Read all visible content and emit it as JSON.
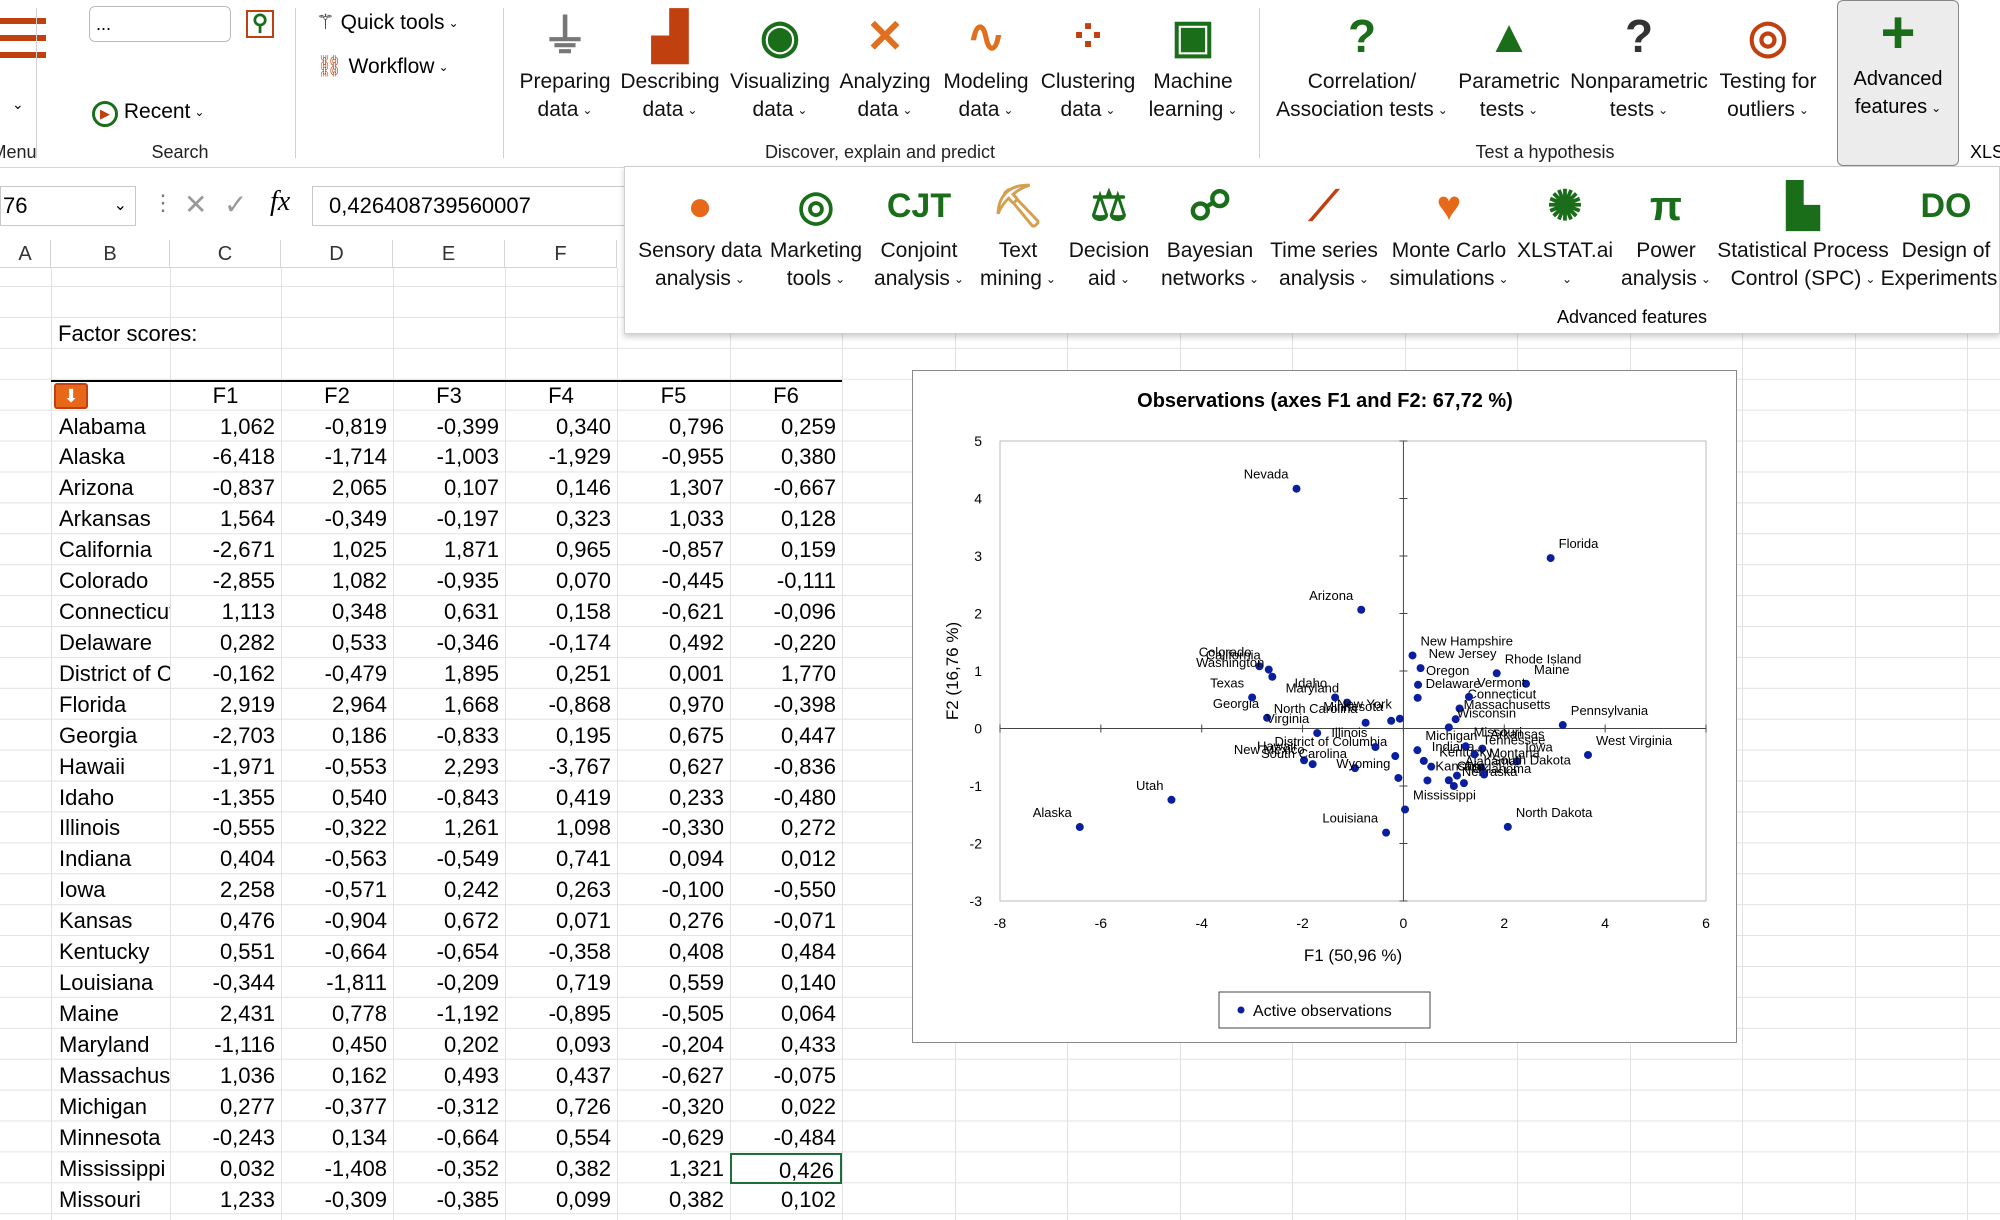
{
  "ribbon": {
    "menu_label": "Menu",
    "search": {
      "value": "...",
      "group_label": "Search",
      "recent_label": "Recent"
    },
    "quick_tools_label": "Quick tools",
    "workflow_label": "Workflow",
    "discover_group_label": "Discover, explain and predict",
    "discover_items": [
      {
        "line1": "Preparing",
        "line2": "data",
        "icon": "funnel-icon"
      },
      {
        "line1": "Describing",
        "line2": "data",
        "icon": "bar-chart-icon"
      },
      {
        "line1": "Visualizing",
        "line2": "data",
        "icon": "eye-icon"
      },
      {
        "line1": "Analyzing",
        "line2": "data",
        "icon": "scatter-cross-icon"
      },
      {
        "line1": "Modeling",
        "line2": "data",
        "icon": "curve-grid-icon"
      },
      {
        "line1": "Clustering",
        "line2": "data",
        "icon": "clusters-icon"
      },
      {
        "line1": "Machine",
        "line2": "learning",
        "icon": "monitor-network-icon"
      }
    ],
    "test_group_label": "Test a hypothesis",
    "test_items": [
      {
        "line1": "Correlation/",
        "line2": "Association tests",
        "icon": "correlation-question-icon"
      },
      {
        "line1": "Parametric",
        "line2": "tests",
        "icon": "bell-curve-icon"
      },
      {
        "line1": "Nonparametric",
        "line2": "tests",
        "icon": "ranks-question-icon"
      },
      {
        "line1": "Testing for",
        "line2": "outliers",
        "icon": "target-icon"
      }
    ],
    "advanced": {
      "line1": "Advanced",
      "line2": "features",
      "icon": "plus-icon"
    },
    "xls_label": "XLS"
  },
  "advanced_panel": {
    "group_label": "Advanced features",
    "items": [
      {
        "line1": "Sensory data",
        "line2": "analysis",
        "icon": "orange-fruit-icon"
      },
      {
        "line1": "Marketing",
        "line2": "tools",
        "icon": "target-cursor-icon"
      },
      {
        "line1": "Conjoint",
        "line2": "analysis",
        "icon": "cjt-icon"
      },
      {
        "line1": "Text",
        "line2": "mining",
        "icon": "pickaxe-text-icon"
      },
      {
        "line1": "Decision",
        "line2": "aid",
        "icon": "decision-icon"
      },
      {
        "line1": "Bayesian",
        "line2": "networks",
        "icon": "network-bn-icon"
      },
      {
        "line1": "Time series",
        "line2": "analysis",
        "icon": "time-series-icon"
      },
      {
        "line1": "Monte Carlo",
        "line2": "simulations",
        "icon": "cards-icon"
      },
      {
        "line1": "XLSTAT.ai",
        "line2": "",
        "icon": "ai-brain-icon"
      },
      {
        "line1": "Power",
        "line2": "analysis",
        "icon": "pi-icon"
      },
      {
        "line1": "Statistical Process",
        "line2": "Control (SPC)",
        "icon": "spc-ruler-icon"
      },
      {
        "line1": "Design of",
        "line2": "Experiments",
        "icon": "doe-icon"
      }
    ]
  },
  "formula_bar": {
    "name_box": "76",
    "formula": "0,426408739560007"
  },
  "columns": [
    "A",
    "B",
    "C",
    "D",
    "E",
    "F"
  ],
  "table": {
    "title": "Factor scores:",
    "headers": [
      "F1",
      "F2",
      "F3",
      "F4",
      "F5",
      "F6"
    ],
    "rows": [
      [
        "Alabama",
        "1,062",
        "-0,819",
        "-0,399",
        "0,340",
        "0,796",
        "0,259"
      ],
      [
        "Alaska",
        "-6,418",
        "-1,714",
        "-1,003",
        "-1,929",
        "-0,955",
        "0,380"
      ],
      [
        "Arizona",
        "-0,837",
        "2,065",
        "0,107",
        "0,146",
        "1,307",
        "-0,667"
      ],
      [
        "Arkansas",
        "1,564",
        "-0,349",
        "-0,197",
        "0,323",
        "1,033",
        "0,128"
      ],
      [
        "California",
        "-2,671",
        "1,025",
        "1,871",
        "0,965",
        "-0,857",
        "0,159"
      ],
      [
        "Colorado",
        "-2,855",
        "1,082",
        "-0,935",
        "0,070",
        "-0,445",
        "-0,111"
      ],
      [
        "Connecticut",
        "1,113",
        "0,348",
        "0,631",
        "0,158",
        "-0,621",
        "-0,096"
      ],
      [
        "Delaware",
        "0,282",
        "0,533",
        "-0,346",
        "-0,174",
        "0,492",
        "-0,220"
      ],
      [
        "District of Columbia",
        "-0,162",
        "-0,479",
        "1,895",
        "0,251",
        "0,001",
        "1,770"
      ],
      [
        "Florida",
        "2,919",
        "2,964",
        "1,668",
        "-0,868",
        "0,970",
        "-0,398"
      ],
      [
        "Georgia",
        "-2,703",
        "0,186",
        "-0,833",
        "0,195",
        "0,675",
        "0,447"
      ],
      [
        "Hawaii",
        "-1,971",
        "-0,553",
        "2,293",
        "-3,767",
        "0,627",
        "-0,836"
      ],
      [
        "Idaho",
        "-1,355",
        "0,540",
        "-0,843",
        "0,419",
        "0,233",
        "-0,480"
      ],
      [
        "Illinois",
        "-0,555",
        "-0,322",
        "1,261",
        "1,098",
        "-0,330",
        "0,272"
      ],
      [
        "Indiana",
        "0,404",
        "-0,563",
        "-0,549",
        "0,741",
        "0,094",
        "0,012"
      ],
      [
        "Iowa",
        "2,258",
        "-0,571",
        "0,242",
        "0,263",
        "-0,100",
        "-0,550"
      ],
      [
        "Kansas",
        "0,476",
        "-0,904",
        "0,672",
        "0,071",
        "0,276",
        "-0,071"
      ],
      [
        "Kentucky",
        "0,551",
        "-0,664",
        "-0,654",
        "-0,358",
        "0,408",
        "0,484"
      ],
      [
        "Louisiana",
        "-0,344",
        "-1,811",
        "-0,209",
        "0,719",
        "0,559",
        "0,140"
      ],
      [
        "Maine",
        "2,431",
        "0,778",
        "-1,192",
        "-0,895",
        "-0,505",
        "0,064"
      ],
      [
        "Maryland",
        "-1,116",
        "0,450",
        "0,202",
        "0,093",
        "-0,204",
        "0,433"
      ],
      [
        "Massachusetts",
        "1,036",
        "0,162",
        "0,493",
        "0,437",
        "-0,627",
        "-0,075"
      ],
      [
        "Michigan",
        "0,277",
        "-0,377",
        "-0,312",
        "0,726",
        "-0,320",
        "0,022"
      ],
      [
        "Minnesota",
        "-0,243",
        "0,134",
        "-0,664",
        "0,554",
        "-0,629",
        "-0,484"
      ],
      [
        "Mississippi",
        "0,032",
        "-1,408",
        "-0,352",
        "0,382",
        "1,321",
        "0,426"
      ],
      [
        "Missouri",
        "1,233",
        "-0,309",
        "-0,385",
        "0,099",
        "0,382",
        "0,102"
      ]
    ]
  },
  "chart_data": {
    "type": "scatter",
    "title": "Observations (axes F1 and F2: 67,72 %)",
    "xlabel": "F1 (50,96 %)",
    "ylabel": "F2 (16,76 %)",
    "xlim": [
      -8,
      6
    ],
    "ylim": [
      -3,
      5
    ],
    "xticks": [
      "-8",
      "-6",
      "-4",
      "-2",
      "0",
      "2",
      "4",
      "6"
    ],
    "yticks": [
      "-3",
      "-2",
      "-1",
      "0",
      "1",
      "2",
      "3",
      "4",
      "5"
    ],
    "legend": {
      "position": "bottom",
      "entries": [
        "Active observations"
      ]
    },
    "color": "#0a1f9e",
    "series": [
      {
        "name": "Active observations",
        "points": [
          [
            "Alabama",
            1.062,
            -0.819
          ],
          [
            "Alaska",
            -6.418,
            -1.714
          ],
          [
            "Arizona",
            -0.837,
            2.065
          ],
          [
            "Arkansas",
            1.564,
            -0.349
          ],
          [
            "California",
            -2.671,
            1.025
          ],
          [
            "Colorado",
            -2.855,
            1.082
          ],
          [
            "Connecticut",
            1.113,
            0.348
          ],
          [
            "Delaware",
            0.282,
            0.533
          ],
          [
            "District of Columbia",
            -0.162,
            -0.479
          ],
          [
            "Florida",
            2.919,
            2.964
          ],
          [
            "Georgia",
            -2.703,
            0.186
          ],
          [
            "Hawaii",
            -1.971,
            -0.553
          ],
          [
            "Idaho",
            -1.355,
            0.54
          ],
          [
            "Illinois",
            -0.555,
            -0.322
          ],
          [
            "Indiana",
            0.404,
            -0.563
          ],
          [
            "Iowa",
            2.258,
            -0.571
          ],
          [
            "Kansas",
            0.476,
            -0.904
          ],
          [
            "Kentucky",
            0.551,
            -0.664
          ],
          [
            "Louisiana",
            -0.344,
            -1.811
          ],
          [
            "Maine",
            2.431,
            0.778
          ],
          [
            "Maryland",
            -1.116,
            0.45
          ],
          [
            "Massachusetts",
            1.036,
            0.162
          ],
          [
            "Michigan",
            0.277,
            -0.377
          ],
          [
            "Minnesota",
            -0.243,
            0.134
          ],
          [
            "Mississippi",
            0.032,
            -1.408
          ],
          [
            "Missouri",
            1.233,
            -0.309
          ],
          [
            "Montana",
            1.54,
            -0.68
          ],
          [
            "Nebraska",
            1.0,
            -1.0
          ],
          [
            "Nevada",
            -2.12,
            4.17
          ],
          [
            "New Hampshire",
            0.18,
            1.27
          ],
          [
            "New Jersey",
            0.34,
            1.05
          ],
          [
            "New Mexico",
            -1.8,
            -0.62
          ],
          [
            "New York",
            -0.07,
            0.17
          ],
          [
            "North Carolina",
            -0.75,
            0.1
          ],
          [
            "North Dakota",
            2.07,
            -1.71
          ],
          [
            "Ohio",
            0.9,
            -0.9
          ],
          [
            "Oklahoma",
            1.2,
            -0.95
          ],
          [
            "Oregon",
            0.29,
            0.76
          ],
          [
            "Pennsylvania",
            3.16,
            0.06
          ],
          [
            "Rhode Island",
            1.85,
            0.96
          ],
          [
            "South Carolina",
            -0.96,
            -0.69
          ],
          [
            "South Dakota",
            1.6,
            -0.8
          ],
          [
            "Tennessee",
            1.41,
            -0.45
          ],
          [
            "Texas",
            -3.0,
            0.54
          ],
          [
            "Utah",
            -4.6,
            -1.24
          ],
          [
            "Vermont",
            1.3,
            0.55
          ],
          [
            "Virginia",
            -1.71,
            -0.08
          ],
          [
            "Washington",
            -2.6,
            0.9
          ],
          [
            "West Virginia",
            3.66,
            -0.46
          ],
          [
            "Wisconsin",
            0.9,
            0.02
          ],
          [
            "Wyoming",
            -0.1,
            -0.86
          ]
        ]
      }
    ]
  }
}
